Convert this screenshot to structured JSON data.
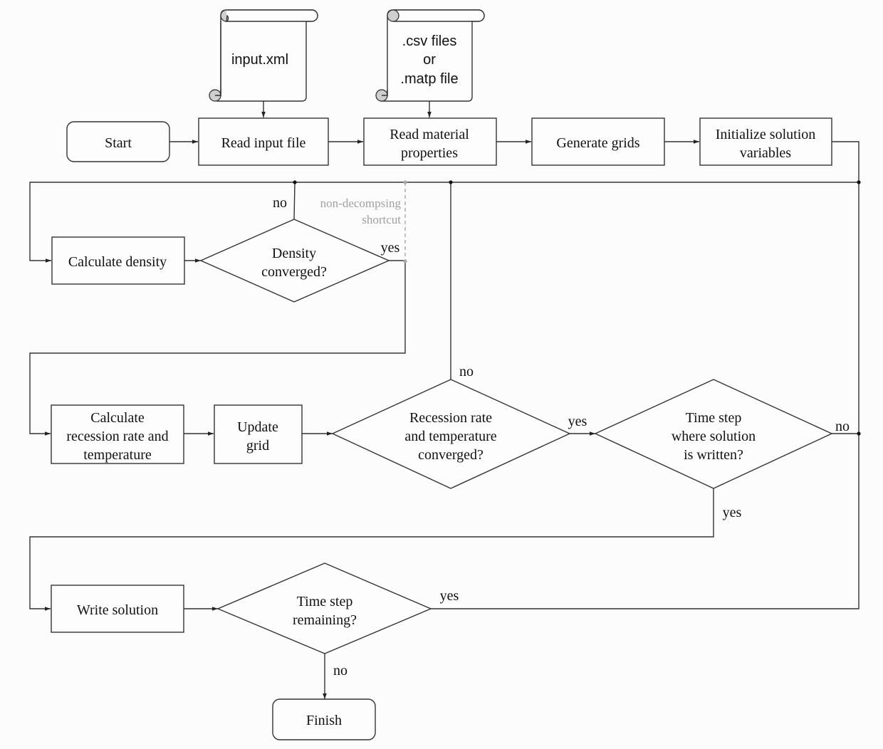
{
  "diagram": {
    "type": "flowchart",
    "documents": {
      "input_xml": "input.xml",
      "material_files": [
        ".csv files",
        "or",
        ".matp file"
      ]
    },
    "nodes": {
      "start": "Start",
      "read_input": "Read input file",
      "read_material": [
        "Read material",
        "properties"
      ],
      "generate_grids": "Generate grids",
      "initialize": [
        "Initialize solution",
        "variables"
      ],
      "calc_density": "Calculate density",
      "density_converged": [
        "Density",
        "converged?"
      ],
      "calc_recession": [
        "Calculate",
        "recession rate and",
        "temperature"
      ],
      "update_grid": [
        "Update",
        "grid"
      ],
      "recession_converged": [
        "Recession rate",
        "and temperature",
        "converged?"
      ],
      "time_step_written": [
        "Time step",
        "where solution",
        "is written?"
      ],
      "write_solution": "Write solution",
      "time_step_remaining": [
        "Time step",
        "remaining?"
      ],
      "finish": "Finish"
    },
    "edge_labels": {
      "density_no": "no",
      "density_yes": "yes",
      "shortcut_note": [
        "non-decompsing",
        "shortcut"
      ],
      "recession_no": "no",
      "recession_yes": "yes",
      "written_no": "no",
      "written_yes": "yes",
      "remaining_yes": "yes",
      "remaining_no": "no"
    },
    "colors": {
      "stroke": "#333333",
      "shortcut": "#a8a8a8",
      "background": "#fcfcfc"
    }
  }
}
